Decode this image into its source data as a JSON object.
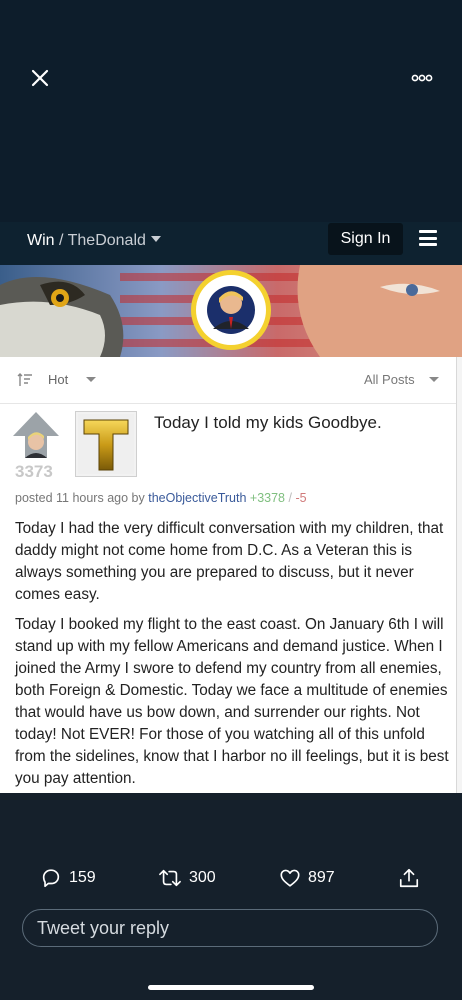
{
  "viewer": {
    "close_icon": "close-icon",
    "more_icon": "more-options-icon"
  },
  "site": {
    "brand": "Win",
    "separator": "/",
    "community": "TheDonald",
    "sign_in": "Sign In",
    "menu_icon": "hamburger-menu-icon",
    "colors": {
      "header_bg": "#0e2230",
      "sign_in_bg": "#08131b"
    }
  },
  "banner": {
    "seal_text": "SEAL OF THE PRESIDENT OF THE UNITED STATES"
  },
  "sortbar": {
    "sort_label": "Hot",
    "filter_label": "All Posts"
  },
  "post": {
    "score": "3373",
    "title": "Today I told my kids Goodbye.",
    "thumbnail_letter": "T",
    "posted": "posted 11 hours ago by",
    "author": "theObjectiveTruth",
    "upvotes": "+3378",
    "slash": "/",
    "downvotes": "-5",
    "paragraphs": [
      "Today I had the very difficult conversation with my children, that daddy might not come home from D.C. As a Veteran this is always something you are prepared to discuss, but it never comes easy.",
      "Today I booked my flight to the east coast. On January 6th I will stand up with my fellow Americans and demand justice. When I joined the Army I swore to defend my country from all enemies, both Foreign & Domestic. Today we face a multitude of enemies that would have us bow down, and surrender our rights. Not today! Not EVER! For those of you watching all of this unfold from the sidelines, know that I harbor no ill feelings, but it is best you pay attention."
    ]
  },
  "tweet_actions": {
    "replies": "159",
    "retweets": "300",
    "likes": "897",
    "reply_placeholder": "Tweet your reply"
  },
  "colors": {
    "background": "#15202b",
    "top_area": "#0d1d2b",
    "author_link": "#3a5a9a",
    "upvote_green": "#7fbf7f",
    "downvote_red": "#d07a7a"
  }
}
